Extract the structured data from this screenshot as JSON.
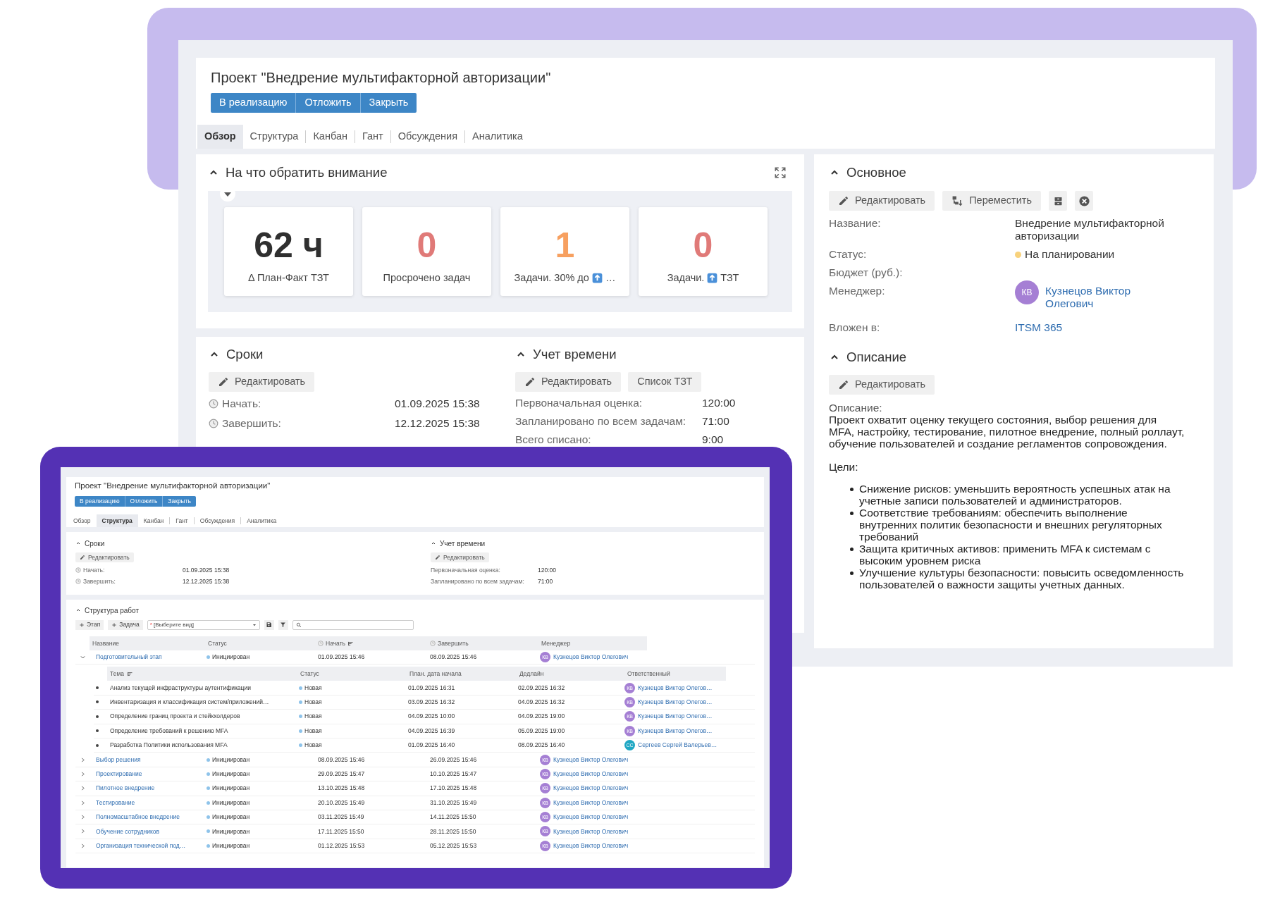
{
  "main_window": {
    "title": "Проект \"Внедрение мультифакторной авторизации\"",
    "actions": [
      "В реализацию",
      "Отложить",
      "Закрыть"
    ],
    "tabs": [
      {
        "label": "Обзор",
        "selected": true
      },
      {
        "label": "Структура",
        "selected": false
      },
      {
        "label": "Канбан",
        "selected": false
      },
      {
        "label": "Гант",
        "selected": false
      },
      {
        "label": "Обсуждения",
        "selected": false
      },
      {
        "label": "Аналитика",
        "selected": false
      }
    ],
    "attention": {
      "title": "На что обратить внимание",
      "kpis": [
        {
          "value": "62 ч",
          "color": "#2f2f2f",
          "label": "Δ План-Факт ТЗТ",
          "up_icon": false
        },
        {
          "value": "0",
          "color": "#e07a78",
          "label": "Просрочено задач",
          "up_icon": false
        },
        {
          "value": "1",
          "color": "#f7a060",
          "label": "Задачи. 30% до",
          "up_icon": true,
          "label_after": "…"
        },
        {
          "value": "0",
          "color": "#e07a78",
          "label": "Задачи.",
          "up_icon": true,
          "label_after": "ТЗТ"
        }
      ]
    },
    "schedule": {
      "title": "Сроки",
      "edit": "Редактировать",
      "fields": [
        {
          "label": "Начать:",
          "value": "01.09.2025 15:38"
        },
        {
          "label": "Завершить:",
          "value": "12.12.2025 15:38"
        }
      ]
    },
    "time_tracking": {
      "title": "Учет времени",
      "actions": [
        {
          "kind": "edit",
          "label": "Редактировать"
        },
        {
          "kind": "list",
          "label": "Список ТЗТ"
        }
      ],
      "fields": [
        {
          "label": "Первоначальная оценка:",
          "value": "120:00"
        },
        {
          "label": "Запланировано по всем задачам:",
          "value": "71:00"
        },
        {
          "label": "Всего списано:",
          "value": "9:00"
        }
      ]
    },
    "basic": {
      "title": "Основное",
      "actions": [
        {
          "kind": "edit",
          "label": "Редактировать"
        },
        {
          "kind": "move",
          "label": "Переместить"
        },
        {
          "kind": "archive"
        },
        {
          "kind": "delete"
        }
      ],
      "fields": [
        {
          "kind": "text",
          "label": "Название:",
          "value": "Внедрение мультифакторной авторизации"
        },
        {
          "kind": "status",
          "label": "Статус:",
          "value": "На планировании"
        },
        {
          "kind": "text",
          "label": "Бюджет (руб.):"
        },
        {
          "kind": "person",
          "label": "Менеджер:",
          "initials": "КВ",
          "value": "Кузнецов Виктор Олегович"
        },
        {
          "kind": "link",
          "label": "Вложен в:",
          "value": "ITSM 365"
        }
      ]
    },
    "description": {
      "title": "Описание",
      "edit": "Редактировать",
      "label": "Описание:",
      "text": "Проект охватит оценку текущего состояния, выбор решения для MFA, настройку, тестирование, пилотное внедрение, полный роллаут, обучение пользователей и создание регламентов сопровождения.",
      "goals_label": "Цели:",
      "goals": [
        "Снижение рисков: уменьшить вероятность успешных атак на учетные записи пользователей и администраторов.",
        "Соответствие требованиям: обеспечить выполнение внутренних политик безопасности и внешних регуляторных требований",
        "Защита критичных активов: применить MFA к системам с высоким уровнем риска",
        "Улучшение культуры безопасности: повысить осведомленность пользователей о важности защиты учетных данных."
      ]
    }
  },
  "inset_window": {
    "title": "Проект \"Внедрение мультифакторной авторизации\"",
    "actions": [
      "В реализацию",
      "Отложить",
      "Закрыть"
    ],
    "tabs": [
      {
        "label": "Обзор",
        "selected": false
      },
      {
        "label": "Структура",
        "selected": true
      },
      {
        "label": "Канбан",
        "selected": false
      },
      {
        "label": "Гант",
        "selected": false
      },
      {
        "label": "Обсуждения",
        "selected": false
      },
      {
        "label": "Аналитика",
        "selected": false
      }
    ],
    "schedule": {
      "title": "Сроки",
      "edit": "Редактировать",
      "fields": [
        {
          "label": "Начать:",
          "value": "01.09.2025 15:38"
        },
        {
          "label": "Завершить:",
          "value": "12.12.2025 15:38"
        }
      ]
    },
    "time_tracking": {
      "title": "Учет времени",
      "edit": "Редактировать",
      "fields": [
        {
          "label": "Первоначальная оценка:",
          "value": "120:00"
        },
        {
          "label": "Запланировано по всем задачам:",
          "value": "71:00"
        }
      ]
    },
    "work_structure": {
      "title": "Структура работ",
      "add_buttons": [
        "Этап",
        "Задача"
      ],
      "view_select": {
        "required_mark": "*",
        "placeholder": "[Выберите вид]"
      },
      "columns": [
        {
          "label": "Название",
          "clock": false,
          "sorted": false
        },
        {
          "label": "Статус",
          "clock": false,
          "sorted": false
        },
        {
          "label": "Начать",
          "clock": true,
          "sorted": true
        },
        {
          "label": "Завершить",
          "clock": true,
          "sorted": false
        },
        {
          "label": "Менеджер",
          "clock": false,
          "sorted": false
        }
      ],
      "rows": [
        {
          "name": "Подготовительный этап",
          "status": "Инициирован",
          "start": "01.09.2025 15:46",
          "end": "08.09.2025 15:46",
          "initials": "КВ",
          "manager": "Кузнецов Виктор Олегович",
          "expanded": true,
          "child_columns": [
            {
              "label": "Тема",
              "sorted": true
            },
            {
              "label": "Статус",
              "sorted": false
            },
            {
              "label": "План. дата начала",
              "sorted": false
            },
            {
              "label": "Дедлайн",
              "sorted": false
            },
            {
              "label": "Ответственный",
              "sorted": false
            }
          ],
          "children": [
            {
              "name": "Анализ текущей инфраструктуры аутентификации",
              "status": "Новая",
              "start": "01.09.2025 16:31",
              "deadline": "02.09.2025 16:32",
              "initials": "КВ",
              "color": "#a57fd4",
              "assignee": "Кузнецов Виктор Олегов…"
            },
            {
              "name": "Инвентаризация и классификация систем/приложений…",
              "status": "Новая",
              "start": "03.09.2025 16:32",
              "deadline": "04.09.2025 16:32",
              "initials": "КВ",
              "color": "#a57fd4",
              "assignee": "Кузнецов Виктор Олегов…"
            },
            {
              "name": "Определение границ проекта и стейкхолдеров",
              "status": "Новая",
              "start": "04.09.2025 10:00",
              "deadline": "04.09.2025 19:00",
              "initials": "КВ",
              "color": "#a57fd4",
              "assignee": "Кузнецов Виктор Олегов…"
            },
            {
              "name": "Определение требований к решению MFA",
              "status": "Новая",
              "start": "04.09.2025 16:39",
              "deadline": "05.09.2025 19:00",
              "initials": "КВ",
              "color": "#a57fd4",
              "assignee": "Кузнецов Виктор Олегов…"
            },
            {
              "name": "Разработка Политики использования MFA",
              "status": "Новая",
              "start": "01.09.2025 16:40",
              "deadline": "08.09.2025 16:40",
              "initials": "СС",
              "color": "#1fa7c4",
              "assignee": "Сергеев Сергей Валерьев…"
            }
          ]
        },
        {
          "name": "Выбор решения",
          "status": "Инициирован",
          "start": "08.09.2025 15:46",
          "end": "26.09.2025 15:46",
          "initials": "КВ",
          "manager": "Кузнецов Виктор Олегович",
          "expanded": false
        },
        {
          "name": "Проектирование",
          "status": "Инициирован",
          "start": "29.09.2025 15:47",
          "end": "10.10.2025 15:47",
          "initials": "КВ",
          "manager": "Кузнецов Виктор Олегович",
          "expanded": false
        },
        {
          "name": "Пилотное внедрение",
          "status": "Инициирован",
          "start": "13.10.2025 15:48",
          "end": "17.10.2025 15:48",
          "initials": "КВ",
          "manager": "Кузнецов Виктор Олегович",
          "expanded": false
        },
        {
          "name": "Тестирование",
          "status": "Инициирован",
          "start": "20.10.2025 15:49",
          "end": "31.10.2025 15:49",
          "initials": "КВ",
          "manager": "Кузнецов Виктор Олегович",
          "expanded": false
        },
        {
          "name": "Полномасштабное внедрение",
          "status": "Инициирован",
          "start": "03.11.2025 15:49",
          "end": "14.11.2025 15:50",
          "initials": "КВ",
          "manager": "Кузнецов Виктор Олегович",
          "expanded": false
        },
        {
          "name": "Обучение сотрудников",
          "status": "Инициирован",
          "start": "17.11.2025 15:50",
          "end": "28.11.2025 15:50",
          "initials": "КВ",
          "manager": "Кузнецов Виктор Олегович",
          "expanded": false
        },
        {
          "name": "Организация технической под…",
          "status": "Инициирован",
          "start": "01.12.2025 15:53",
          "end": "05.12.2025 15:53",
          "initials": "КВ",
          "manager": "Кузнецов Виктор Олегович",
          "expanded": false
        }
      ]
    }
  }
}
